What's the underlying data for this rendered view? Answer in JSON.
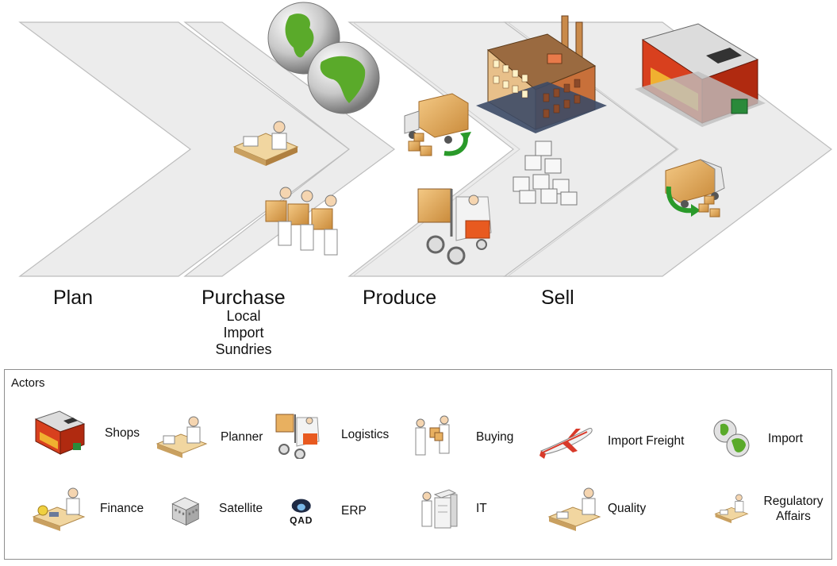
{
  "stages": [
    {
      "label": "Plan"
    },
    {
      "label": "Purchase",
      "sublabels": [
        "Local",
        "Import",
        "Sundries"
      ]
    },
    {
      "label": "Produce"
    },
    {
      "label": "Sell"
    }
  ],
  "actors_panel": {
    "title": "Actors",
    "items": [
      {
        "label": "Shops",
        "icon": "shop-icon"
      },
      {
        "label": "Planner",
        "icon": "planner-icon"
      },
      {
        "label": "Logistics",
        "icon": "forklift-icon"
      },
      {
        "label": "Buying",
        "icon": "buyers-icon"
      },
      {
        "label": "Import Freight",
        "icon": "airplane-icon"
      },
      {
        "label": "Import",
        "icon": "globes-icon"
      },
      {
        "label": "Finance",
        "icon": "finance-desk-icon"
      },
      {
        "label": "Satellite",
        "icon": "satellite-building-icon"
      },
      {
        "label": "ERP",
        "icon": "qad-logo-icon",
        "logo_text": "QAD"
      },
      {
        "label": "IT",
        "icon": "server-icon"
      },
      {
        "label": "Quality",
        "icon": "quality-desk-icon"
      },
      {
        "label": "Regulatory Affairs",
        "icon": "regulatory-desk-icon"
      }
    ]
  },
  "colors": {
    "band_fill": "#ececec",
    "band_stroke": "#bdbdbd",
    "globe_green": "#5aaa2a",
    "box_tan": "#e8b060",
    "factory_brick": "#c8703a",
    "shop_red": "#c83020",
    "arrow_green": "#2a9a2a"
  }
}
